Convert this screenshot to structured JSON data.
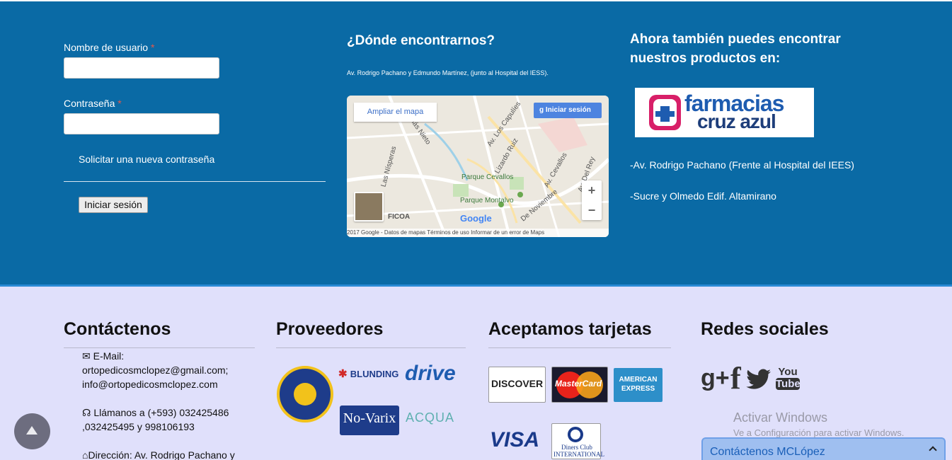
{
  "login": {
    "username_label": "Nombre de usuario",
    "password_label": "Contraseña",
    "required_mark": "*",
    "forgot_link": "Solicitar una nueva contraseña",
    "submit_label": "Iniciar sesión"
  },
  "location": {
    "title": "¿Dónde encontrarnos?",
    "address": "Av. Rodrigo Pachano y Edmundo Martínez, (junto al Hospital del IESS).",
    "map": {
      "enlarge_label": "Ampliar el mapa",
      "signin_label": "Iniciar sesión",
      "zoom_in": "+",
      "zoom_out": "−",
      "places": [
        "Parque Cevallos",
        "Parque Montalvo",
        "FICOA",
        "Lizardo Ruiz",
        "Av. Cevallos",
        "Av. Del Rey",
        "De Noviembre",
        "Av. Los Capulíes",
        "Las Nísperas",
        "Tomás Nieto"
      ],
      "footer": "2017 Google - Datos de mapas    Términos de uso    Informar de un error de Maps",
      "google": "Google"
    }
  },
  "stores": {
    "title": "Ahora también puedes encontrar nuestros productos en:",
    "logo_text_top": "farmacias",
    "logo_text_bottom": "cruz azul",
    "addresses": [
      "-Av. Rodrigo Pachano (Frente al Hospital del IEES)",
      "-Sucre y Olmedo Edif. Altamirano"
    ]
  },
  "footer": {
    "contact": {
      "title": "Contáctenos",
      "email_label": "E-Mail:",
      "emails": "ortopedicosmclopez@gmail.com; info@ortopedicosmclopez.com",
      "phone": "Llámanos a (+593) 032425486 ,032425495 y 998106193",
      "address": "Dirección: Av. Rodrigo Pachano y"
    },
    "providers": {
      "title": "Proveedores",
      "logos": [
        "ORTHO PAUHER",
        "BLUNDING",
        "drive",
        "No-Varix",
        "ACQUA"
      ]
    },
    "cards": {
      "title": "Aceptamos tarjetas",
      "logos": [
        "DISCOVER",
        "MasterCard",
        "AMERICAN EXPRESS",
        "VISA",
        "Diners Club INTERNATIONAL"
      ]
    },
    "social": {
      "title": "Redes sociales",
      "icons": [
        "google-plus-icon",
        "facebook-icon",
        "twitter-icon",
        "youtube-icon"
      ],
      "g_label": "g+",
      "f_label": "f",
      "you_label": "You",
      "tube_label": "Tube"
    }
  },
  "windows": {
    "activate_title": "Activar Windows",
    "activate_sub": "Ve a Configuración para activar Windows."
  },
  "chat": {
    "label": "Contáctenos MCLópez"
  },
  "colors": {
    "top_bg": "#0a6aa5",
    "bottom_bg": "#e0e0fb",
    "accent_blue": "#2a8ad4",
    "required_red": "#e4574a"
  }
}
